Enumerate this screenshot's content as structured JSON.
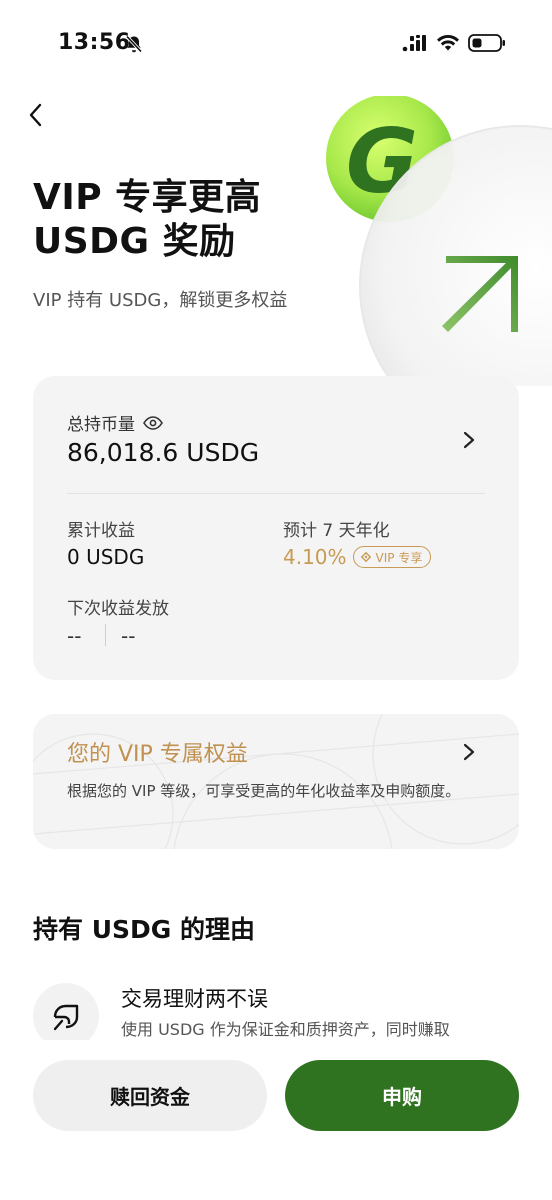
{
  "status_bar": {
    "time": "13:56"
  },
  "hero": {
    "title": "VIP 专享更高\nUSDG 奖励",
    "subtitle": "VIP 持有 USDG，解锁更多权益",
    "logo_letter": "G"
  },
  "holdings": {
    "total_label": "总持币量",
    "total_value": "86,018.6 USDG",
    "cumulative_label": "累计收益",
    "cumulative_value": "0 USDG",
    "apy_label": "预计 7 天年化",
    "apy_value": "4.10%",
    "vip_badge": "VIP 专享",
    "next_payout_label": "下次收益发放",
    "next_payout_date": "--",
    "next_payout_amount": "--"
  },
  "vip_benefits": {
    "title": "您的 VIP 专属权益",
    "description": "根据您的 VIP 等级，可享受更高的年化收益率及申购额度。"
  },
  "reasons": {
    "heading": "持有 USDG 的理由",
    "items": [
      {
        "title": "交易理财两不误",
        "description": "使用 USDG 作为保证金和质押资产，同时赚取",
        "icon": "leaf-icon"
      }
    ]
  },
  "actions": {
    "redeem_label": "赎回资金",
    "subscribe_label": "申购"
  },
  "colors": {
    "accent_green": "#2f7320",
    "gold": "#c89b55",
    "card_bg": "#f4f4f4"
  }
}
